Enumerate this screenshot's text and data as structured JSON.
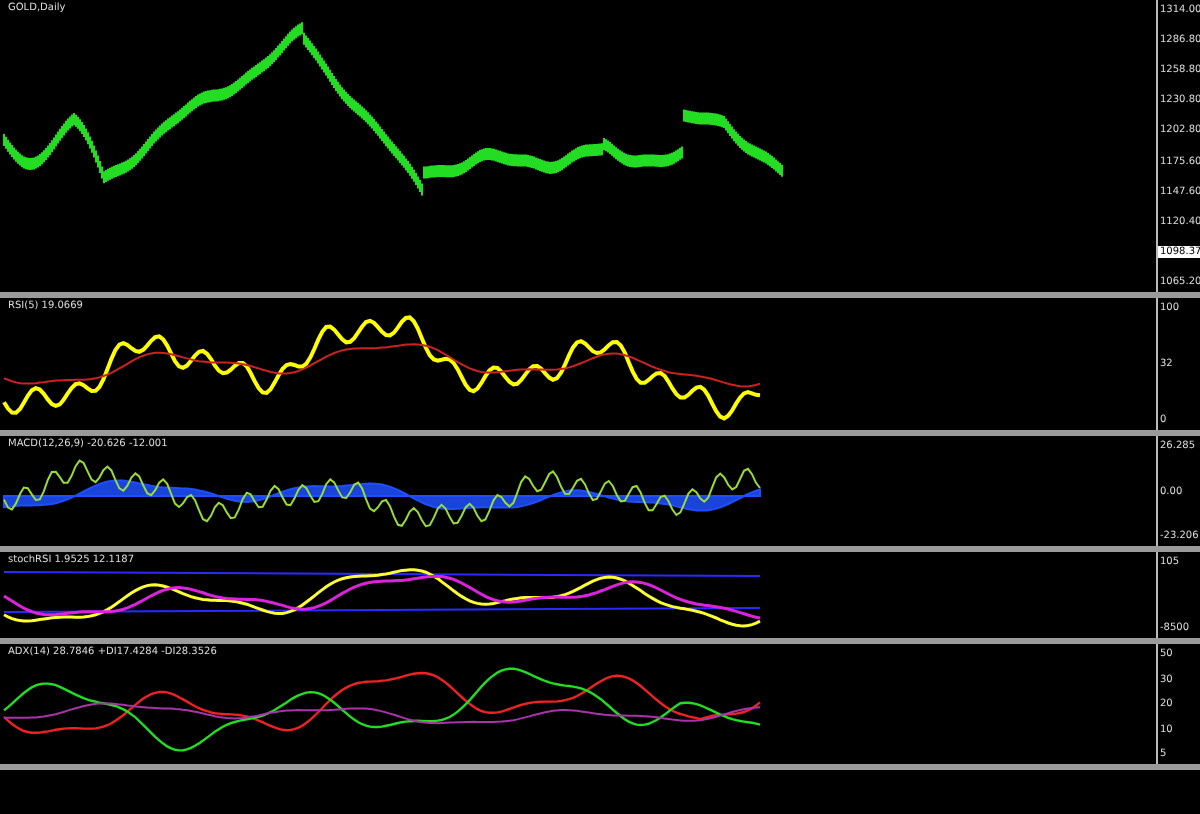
{
  "chart_title": "GOLD,Daily",
  "panes": [
    {
      "kind": "price",
      "ticks": [
        {
          "text": "1314.00",
          "highlighted": false
        },
        {
          "text": "1286.80",
          "highlighted": false
        },
        {
          "text": "1258.80",
          "highlighted": false
        },
        {
          "text": "1230.80",
          "highlighted": false
        },
        {
          "text": "1202.80",
          "highlighted": false
        },
        {
          "text": "1175.60",
          "highlighted": false
        },
        {
          "text": "1147.60",
          "highlighted": false
        },
        {
          "text": "1120.40",
          "highlighted": false
        },
        {
          "text": "1098.37",
          "highlighted": true
        },
        {
          "text": "1065.20",
          "highlighted": false
        }
      ]
    },
    {
      "kind": "rsi",
      "label": "RSI(5) 19.0669",
      "ticks": [
        {
          "text": "100",
          "highlighted": false
        },
        {
          "text": "32",
          "highlighted": false
        },
        {
          "text": "0",
          "highlighted": false
        }
      ]
    },
    {
      "kind": "macd",
      "label": "MACD(12,26,9) -20.626 -12.001",
      "ticks": [
        {
          "text": "26.285",
          "highlighted": false
        },
        {
          "text": "0.00",
          "highlighted": false
        },
        {
          "text": "-23.206",
          "highlighted": false
        }
      ]
    },
    {
      "kind": "stoch",
      "label": "stochRSI 1.9525 12.1187",
      "ticks": [
        {
          "text": "105",
          "highlighted": false
        },
        {
          "text": "-8500",
          "highlighted": false
        }
      ]
    },
    {
      "kind": "adx",
      "label": "ADX(14) 28.7846 +DI17.4284 -DI28.3526",
      "ticks": [
        {
          "text": "50",
          "highlighted": false
        },
        {
          "text": "30",
          "highlighted": false
        },
        {
          "text": "20",
          "highlighted": false
        },
        {
          "text": "10",
          "highlighted": false
        },
        {
          "text": "5",
          "highlighted": false
        }
      ]
    }
  ]
}
